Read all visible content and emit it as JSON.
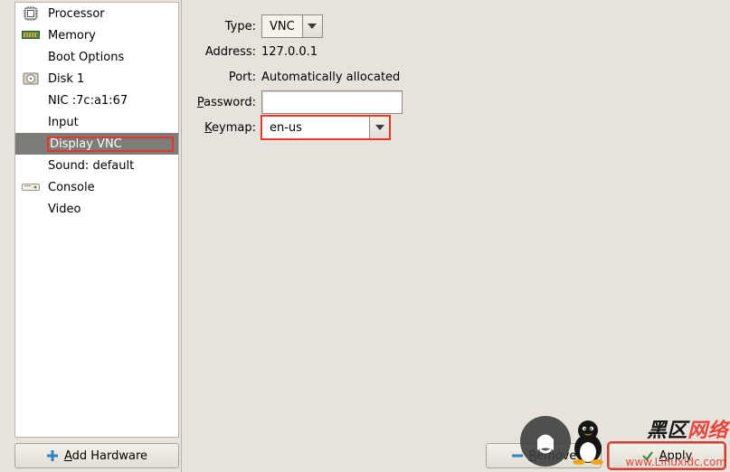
{
  "sidebar": {
    "items": [
      {
        "label": "Processor",
        "icon": "cpu-icon"
      },
      {
        "label": "Memory",
        "icon": "memory-icon"
      },
      {
        "label": "Boot Options",
        "icon": ""
      },
      {
        "label": "Disk 1",
        "icon": "disk-icon"
      },
      {
        "label": "NIC :7c:a1:67",
        "icon": ""
      },
      {
        "label": "Input",
        "icon": ""
      },
      {
        "label": "Display VNC",
        "icon": ""
      },
      {
        "label": "Sound: default",
        "icon": ""
      },
      {
        "label": "Console",
        "icon": "console-icon"
      },
      {
        "label": "Video",
        "icon": ""
      }
    ],
    "selected_index": 6,
    "add_hardware_label": "Add Hardware"
  },
  "details": {
    "header_trailing": "",
    "rows": {
      "type": {
        "label": "Type:",
        "value": "VNC"
      },
      "address": {
        "label": "Address:",
        "value": "127.0.0.1"
      },
      "port": {
        "label": "Port:",
        "value": "Automatically allocated"
      },
      "password": {
        "label": "Password:",
        "value": ""
      },
      "keymap": {
        "label": "Keymap:",
        "value": "en-us"
      }
    },
    "buttons": {
      "remove": "Remove",
      "apply": "Apply"
    }
  },
  "highlights": {
    "display_vnc": true,
    "keymap": true,
    "apply": true
  },
  "watermark": {
    "text1_a": "黑区",
    "text1_b": "网络",
    "text2": "www.Linuxidc.com"
  }
}
